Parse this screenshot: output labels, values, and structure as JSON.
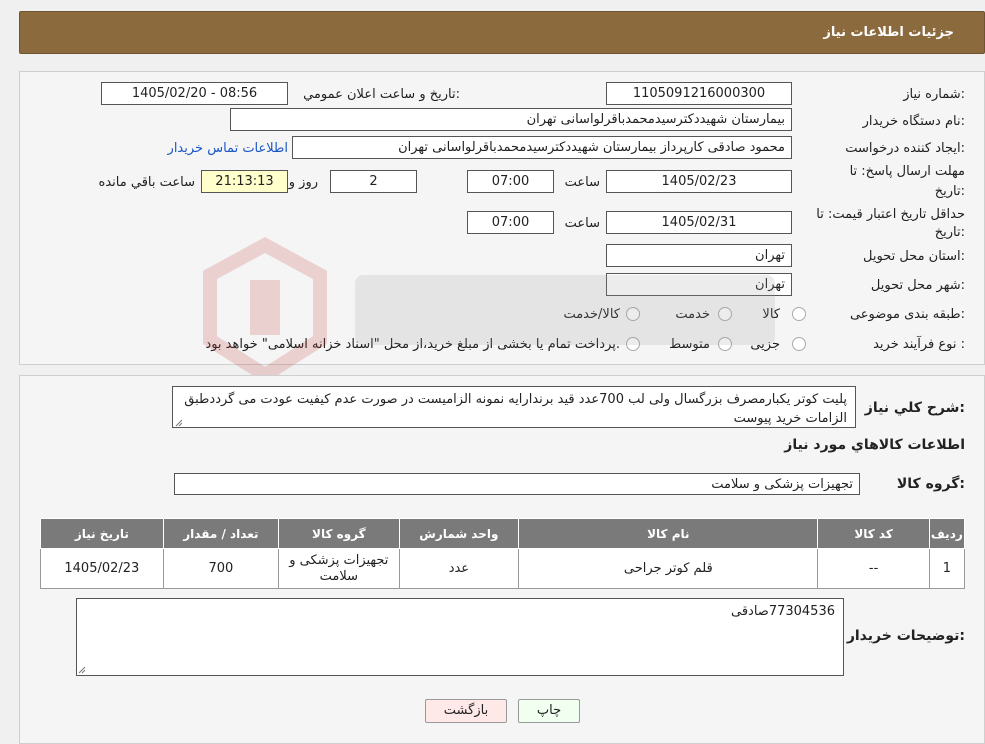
{
  "header": {
    "title": "جزئیات اطلاعات نیاز"
  },
  "fields": {
    "need_number_label": "شماره نیاز:",
    "need_number": "1105091216000300",
    "announce_label": "تاريخ و ساعت اعلان عمومي:",
    "announce_value": "1405/02/20 - 08:56",
    "buyer_org_label": "نام دستگاه خریدار:",
    "buyer_org": "بیمارستان شهیددکترسیدمحمدباقرلواسانی تهران",
    "requester_label": "ایجاد کننده درخواست:",
    "requester": "محمود صادقی کارپرداز بیمارستان شهیددکترسیدمحمدباقرلواسانی تهران",
    "contact_link": "اطلاعات تماس خریدار",
    "deadline_label_1": "مهلت ارسال پاسخ: تا",
    "deadline_label_2": "تاریخ:",
    "deadline_date": "1405/02/23",
    "time_label": "ساعت",
    "deadline_time": "07:00",
    "days_value": "2",
    "days_label": "روز و",
    "remaining_time": "21:13:13",
    "remaining_label": "ساعت باقي مانده",
    "validity_label_1": "حداقل تاریخ اعتبار قیمت: تا",
    "validity_label_2": "تاریخ:",
    "validity_date": "1405/02/31",
    "validity_time": "07:00",
    "province_label": "استان محل تحویل:",
    "province": "تهران",
    "city_label": "شهر محل تحویل:",
    "city": "تهران",
    "category_label": "طبقه بندی موضوعی:",
    "category_options": [
      "کالا",
      "خدمت",
      "کالا/خدمت"
    ],
    "process_label": "نوع فرآیند خرید :",
    "process_options": [
      "جزیی",
      "متوسط"
    ],
    "process_note": "پرداخت تمام یا بخشی از مبلغ خرید،از محل \"اسناد خزانه اسلامی\" خواهد بود."
  },
  "summary": {
    "label": "شرح کلي نياز:",
    "text": "پلیت کوتر یکبارمصرف بزرگسال ولی لب 700عدد قید برندارایه نمونه الزامیست در صورت عدم کیفیت عودت می گرددطبق الزامات خرید پیوست"
  },
  "goods": {
    "section_title": "اطلاعات کالاهاي مورد نياز",
    "group_label": "گروه کالا:",
    "group_value": "تجهیزات پزشکی و سلامت",
    "columns": [
      "رديف",
      "کد کالا",
      "نام کالا",
      "واحد شمارش",
      "گروه کالا",
      "تعداد / مقدار",
      "تاریخ نیاز"
    ],
    "rows": [
      {
        "index": "1",
        "code": "--",
        "name": "قلم کوتر جراحی",
        "unit": "عدد",
        "group": "تجهیزات پزشکی و سلامت",
        "qty": "700",
        "date": "1405/02/23"
      }
    ]
  },
  "buyer_notes": {
    "label": "توضیحات خریدار:",
    "text": "77304536صادقی"
  },
  "buttons": {
    "print": "چاپ",
    "back": "بازگشت"
  },
  "colors": {
    "header": "#8b6a3e",
    "table_header": "#7a7a7a",
    "remaining_bg": "#ffffcc",
    "back_btn": "#ffe8e8",
    "print_btn": "#f0fff0",
    "link": "#1a56c8"
  }
}
